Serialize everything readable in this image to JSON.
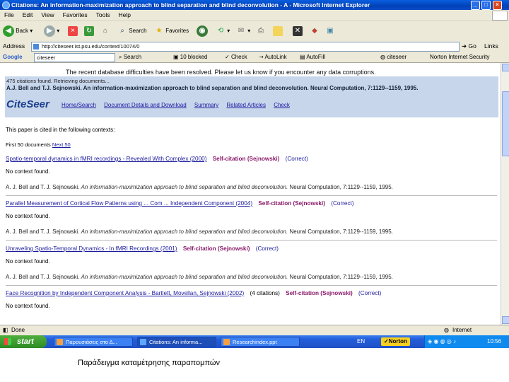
{
  "window": {
    "title": "Citations: An information-maximization approach to blind separation and blind deconvolution - A - Microsoft Internet Explorer"
  },
  "menu": [
    "File",
    "Edit",
    "View",
    "Favorites",
    "Tools",
    "Help"
  ],
  "toolbar": {
    "back": "Back",
    "search": "Search",
    "favorites": "Favorites"
  },
  "address": {
    "label": "Address",
    "url": "http://citeseer.ist.psu.edu/context/10074/0",
    "go": "Go",
    "links": "Links"
  },
  "googlebar": {
    "brand": "Google",
    "query": "citeseer",
    "search": "Search",
    "blocked": "10 blocked",
    "check": "Check",
    "autolink": "AutoLink",
    "autofill": "AutoFill",
    "citeseer": "citeseer",
    "norton": "Norton Internet Security"
  },
  "page": {
    "notice": "The recent database difficulties have been resolved. Please let us know if you encounter any data corruptions.",
    "in_progress": "475 citations found. Retrieving documents...",
    "doc_title": "A.J. Bell and T.J. Sejnowski. An information-maximization approach to blind separation and blind deconvolution. Neural Computation, 7:1129--1159, 1995.",
    "logo": "CiteSeer",
    "nav": [
      "Home/Search",
      "Document Details and Download",
      "Summary",
      "Related Articles",
      "Check"
    ],
    "cited_text": "This paper is cited in the following contexts:",
    "results_label": "First 50 documents",
    "results_next": "Next 50"
  },
  "entries": [
    {
      "title": "Spatio-temporal dynamics in fMRI recordings - Revealed With Complex (2000)",
      "self": "Self-citation (Sejnowski)",
      "correct": "(Correct)",
      "no_context": "No context found.",
      "ref_authors": "A. J. Bell and T. J. Sejnowski.",
      "ref_title": "An information-maximization approach to blind separation and blind deconvolution.",
      "ref_rest": "Neural Computation, 7:1129--1159, 1995."
    },
    {
      "title": "Parallel Measurement of Cortical Flow Patterns using ... Com ... Independent Component (2004)",
      "self": "Self-citation (Sejnowski)",
      "correct": "(Correct)",
      "no_context": "No context found.",
      "ref_authors": "A. J. Bell and T. J. Sejnowski.",
      "ref_title": "An information-maximization approach to blind separation and blind deconvolution.",
      "ref_rest": "Neural Computation, 7:1129--1159, 1995."
    },
    {
      "title": "Unraveling Spatio-Temporal Dynamics - In fMRI Recordings (2001)",
      "self": "Self-citation (Sejnowski)",
      "correct": "(Correct)",
      "no_context": "No context found.",
      "ref_authors": "A. J. Bell and T. J. Sejnowski.",
      "ref_title": "An information-maximization approach to blind separation and blind deconvolution.",
      "ref_rest": "Neural Computation, 7:1129--1159, 1995."
    },
    {
      "title": "Face Recognition by Independent Component Analysis - Bartlett, Movellan, Sejnowski (2002)",
      "self": "Self-citation (Sejnowski)",
      "correct": "(Correct)",
      "extra": "(4 citations)",
      "no_context": "No context found."
    }
  ],
  "status": {
    "text": "Done",
    "zone": "Internet"
  },
  "taskbar": {
    "start": "start",
    "tasks": [
      "Παρουσιάσεις στο Δ...",
      "Citations: An informa...",
      "Researchindex.ppt"
    ],
    "tray_lang": "EN",
    "norton": "Norton",
    "clock": "10:56 πμ"
  },
  "caption": "Παράδειγμα καταμέτρησης παραπομπών"
}
